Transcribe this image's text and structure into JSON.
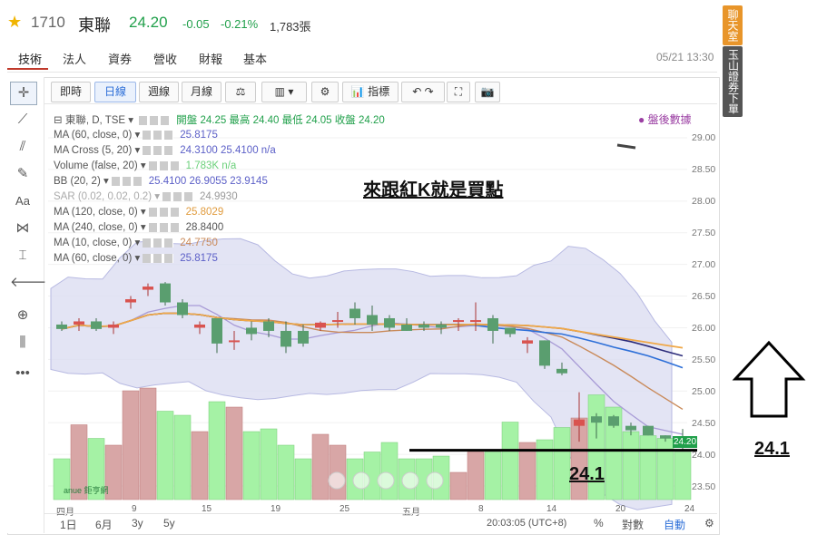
{
  "header": {
    "star": "★",
    "code": "1710",
    "name": "東聯",
    "price": "24.20",
    "change": "-0.05",
    "percent": "-0.21%",
    "volume": "1,783張",
    "datetime": "05/21 13:30"
  },
  "nav_tabs": [
    "技術",
    "法人",
    "資券",
    "營收",
    "財報",
    "基本"
  ],
  "side_panel": {
    "chat": "聊天室",
    "ad": "玉山證券下單"
  },
  "toolbar": {
    "intraday": "即時",
    "daily": "日線",
    "weekly": "週線",
    "monthly": "月線",
    "indicators": "指標"
  },
  "legend": [
    {
      "label": "東聯, D, TSE",
      "values": "開盤 24.25 最高 24.40 最低 24.05 收盤 24.20"
    },
    {
      "label": "MA (60, close, 0)",
      "values": "25.8175"
    },
    {
      "label": "MA Cross (5, 20)",
      "values": "24.3100  25.4100  n/a"
    },
    {
      "label": "Volume (false, 20)",
      "values": "1.783K  n/a"
    },
    {
      "label": "BB (20, 2)",
      "values": "25.4100  26.9055  23.9145"
    },
    {
      "label": "SAR (0.02, 0.02, 0.2)",
      "values": "24.9930"
    },
    {
      "label": "MA (120, close, 0)",
      "values": "25.8029"
    },
    {
      "label": "MA (240, close, 0)",
      "values": "28.8400"
    },
    {
      "label": "MA (10, close, 0)",
      "values": "24.7750"
    },
    {
      "label": "MA (60, close, 0)",
      "values": "25.8175"
    }
  ],
  "after_hours": "● 盤後數據",
  "annotation": "來跟紅K就是買點",
  "level_label": "24.1",
  "current_price_badge": "24.20",
  "y_axis": [
    "29.00",
    "28.50",
    "28.00",
    "27.50",
    "27.00",
    "26.50",
    "26.00",
    "25.50",
    "25.00",
    "24.50",
    "24.00",
    "23.50"
  ],
  "x_axis": [
    "四月",
    "9",
    "15",
    "19",
    "25",
    "五月",
    "8",
    "14",
    "20",
    "24"
  ],
  "bottom_bar": {
    "d1": "1日",
    "m6": "6月",
    "y3": "3y",
    "y5": "5y",
    "time": "20:03:05 (UTC+8)",
    "pct": "%",
    "log": "對數",
    "auto": "自動"
  },
  "logo": "anue 鉅亨網",
  "colors": {
    "up": "#d9534f",
    "down": "#5a9e6f",
    "bb_fill": "#d9dbf0",
    "ma_orange": "#f0a848",
    "ma_navy": "#2c2c7a",
    "ma_blue": "#2d6fd8",
    "ma_brown": "#c98a5a",
    "ma_lilac": "#a89bd6"
  },
  "chart_data": {
    "type": "candlestick",
    "candles": [
      {
        "o": 26.05,
        "h": 26.1,
        "l": 25.95,
        "c": 25.98
      },
      {
        "o": 26.05,
        "h": 26.15,
        "l": 25.95,
        "c": 26.1
      },
      {
        "o": 26.1,
        "h": 26.15,
        "l": 25.95,
        "c": 25.98
      },
      {
        "o": 26.0,
        "h": 26.1,
        "l": 25.9,
        "c": 26.05
      },
      {
        "o": 26.4,
        "h": 26.5,
        "l": 26.3,
        "c": 26.45
      },
      {
        "o": 26.6,
        "h": 26.7,
        "l": 26.5,
        "c": 26.65
      },
      {
        "o": 26.7,
        "h": 26.72,
        "l": 26.35,
        "c": 26.4
      },
      {
        "o": 26.4,
        "h": 26.45,
        "l": 26.15,
        "c": 26.2
      },
      {
        "o": 26.0,
        "h": 26.1,
        "l": 25.9,
        "c": 26.05
      },
      {
        "o": 26.15,
        "h": 26.15,
        "l": 25.6,
        "c": 25.75
      },
      {
        "o": 25.8,
        "h": 25.95,
        "l": 25.65,
        "c": 25.8
      },
      {
        "o": 26.0,
        "h": 26.1,
        "l": 25.8,
        "c": 25.9
      },
      {
        "o": 26.1,
        "h": 26.15,
        "l": 25.85,
        "c": 25.95
      },
      {
        "o": 25.95,
        "h": 26.1,
        "l": 25.6,
        "c": 25.7
      },
      {
        "o": 25.95,
        "h": 26.05,
        "l": 25.7,
        "c": 25.75
      },
      {
        "o": 26.0,
        "h": 26.1,
        "l": 25.95,
        "c": 26.08
      },
      {
        "o": 26.1,
        "h": 26.25,
        "l": 26.0,
        "c": 26.12
      },
      {
        "o": 26.3,
        "h": 26.4,
        "l": 26.05,
        "c": 26.15
      },
      {
        "o": 26.2,
        "h": 26.35,
        "l": 25.95,
        "c": 26.05
      },
      {
        "o": 26.15,
        "h": 26.2,
        "l": 25.95,
        "c": 26.0
      },
      {
        "o": 26.05,
        "h": 26.15,
        "l": 25.95,
        "c": 25.95
      },
      {
        "o": 26.05,
        "h": 26.1,
        "l": 25.95,
        "c": 26.0
      },
      {
        "o": 26.05,
        "h": 26.1,
        "l": 25.9,
        "c": 26.0
      },
      {
        "o": 26.1,
        "h": 26.15,
        "l": 25.95,
        "c": 26.12
      },
      {
        "o": 26.12,
        "h": 26.4,
        "l": 25.95,
        "c": 26.12
      },
      {
        "o": 26.15,
        "h": 26.2,
        "l": 25.75,
        "c": 25.95
      },
      {
        "o": 26.0,
        "h": 26.0,
        "l": 25.85,
        "c": 25.9
      },
      {
        "o": 25.75,
        "h": 25.85,
        "l": 25.6,
        "c": 25.8
      },
      {
        "o": 25.8,
        "h": 25.8,
        "l": 25.35,
        "c": 25.4
      },
      {
        "o": 25.35,
        "h": 25.45,
        "l": 25.25,
        "c": 25.28
      },
      {
        "o": 24.45,
        "h": 24.98,
        "l": 24.2,
        "c": 24.55
      },
      {
        "o": 24.6,
        "h": 24.65,
        "l": 24.25,
        "c": 24.5
      },
      {
        "o": 24.6,
        "h": 24.62,
        "l": 24.42,
        "c": 24.45
      },
      {
        "o": 24.45,
        "h": 24.5,
        "l": 24.3,
        "c": 24.38
      },
      {
        "o": 24.45,
        "h": 24.45,
        "l": 24.3,
        "c": 24.3
      },
      {
        "o": 24.3,
        "h": 24.3,
        "l": 24.2,
        "c": 24.25
      },
      {
        "o": 24.25,
        "h": 24.4,
        "l": 24.05,
        "c": 24.2
      }
    ],
    "volume_relative": [
      0.3,
      0.55,
      0.45,
      0.4,
      0.8,
      0.82,
      0.65,
      0.62,
      0.5,
      0.72,
      0.68,
      0.5,
      0.52,
      0.4,
      0.3,
      0.48,
      0.4,
      0.3,
      0.35,
      0.42,
      0.3,
      0.3,
      0.32,
      0.2,
      0.35,
      0.35,
      0.57,
      0.42,
      0.44,
      0.53,
      0.6,
      0.77,
      0.68,
      0.5,
      0.47,
      0.45,
      0.35
    ],
    "ylim": [
      23.3,
      29.2
    ]
  }
}
